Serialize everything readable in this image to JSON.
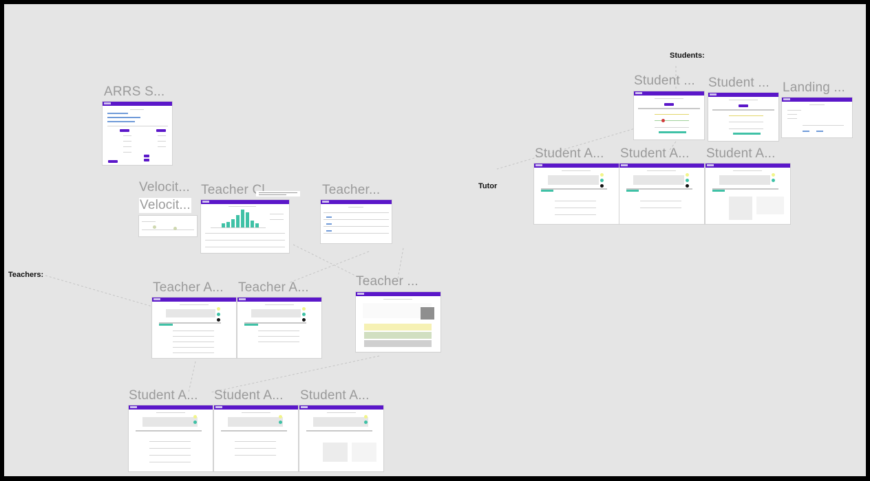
{
  "canvas": {
    "section_labels": {
      "students": "Students:",
      "tutor": "Tutor",
      "teachers": "Teachers:"
    },
    "frames": [
      {
        "id": "arrs",
        "title": "ARRS S..."
      },
      {
        "id": "velocity-1",
        "title": "Velocit..."
      },
      {
        "id": "velocity-2",
        "title": "Velocit..."
      },
      {
        "id": "teacher-cl",
        "title": "Teacher Cl..."
      },
      {
        "id": "teacher-top",
        "title": "Teacher..."
      },
      {
        "id": "teacher-a-1",
        "title": "Teacher A..."
      },
      {
        "id": "teacher-a-2",
        "title": "Teacher A..."
      },
      {
        "id": "teacher-mid",
        "title": "Teacher ..."
      },
      {
        "id": "student-a-bottom-1",
        "title": "Student A..."
      },
      {
        "id": "student-a-bottom-2",
        "title": "Student A..."
      },
      {
        "id": "student-a-bottom-3",
        "title": "Student A..."
      },
      {
        "id": "student-top-1",
        "title": "Student ..."
      },
      {
        "id": "student-top-2",
        "title": "Student ..."
      },
      {
        "id": "landing",
        "title": "Landing ..."
      },
      {
        "id": "student-a-right-1",
        "title": "Student A..."
      },
      {
        "id": "student-a-right-2",
        "title": "Student A..."
      },
      {
        "id": "student-a-right-3",
        "title": "Student A..."
      }
    ]
  },
  "colors": {
    "canvas_bg": "#e5e5e5",
    "frame_header": "#5b17c9",
    "frame_title": "#9a9a9a",
    "bar_teal": "#3fc1a6"
  }
}
